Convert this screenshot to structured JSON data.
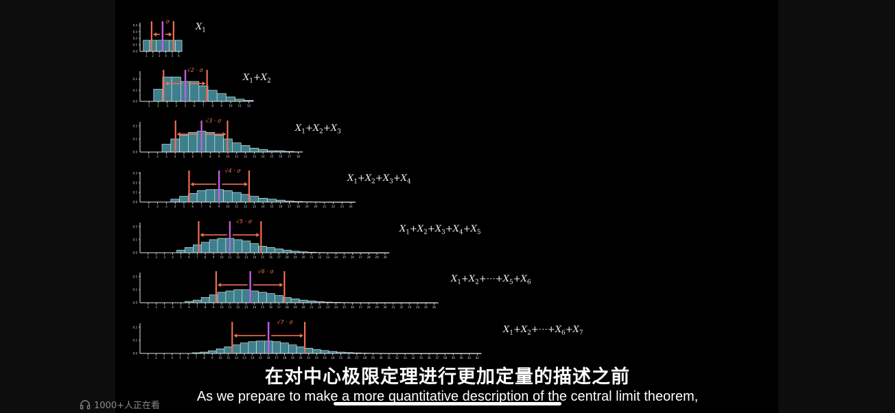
{
  "chart_data": [
    {
      "type": "bar",
      "label": "X_1",
      "var_main": "X",
      "var_sub": "1",
      "sigma_mult": "σ",
      "categories": [
        1,
        2,
        3,
        4,
        5,
        6
      ],
      "values": [
        0.17,
        0.17,
        0.17,
        0.17,
        0.17,
        0.17
      ],
      "xticks": [
        "1",
        "2",
        "3",
        "4",
        "5",
        "6"
      ],
      "yticks": [
        "0.1",
        "0.2",
        "0.3",
        "0.4"
      ],
      "ylim": [
        0,
        0.42
      ],
      "mean": 3.5
    },
    {
      "type": "bar",
      "label": "X_1 + X_2",
      "sigma_mult": "√2 · σ",
      "categories": [
        2,
        3,
        4,
        5,
        6,
        7,
        8,
        9,
        10,
        11,
        12
      ],
      "values": [
        0.11,
        0.22,
        0.22,
        0.18,
        0.18,
        0.14,
        0.1,
        0.07,
        0.04,
        0.02,
        0.01
      ],
      "xticks": [
        "1",
        "2",
        "3",
        "4",
        "5",
        "6",
        "7",
        "8",
        "9",
        "10",
        "11",
        "12"
      ],
      "yticks": [
        "0.1",
        "0.2"
      ],
      "ylim": [
        0,
        0.26
      ],
      "mean": 5.0
    },
    {
      "type": "bar",
      "label": "X_1 + X_2 + X_3",
      "sigma_mult": "√3 · σ",
      "categories": [
        3,
        4,
        5,
        6,
        7,
        8,
        9,
        10,
        11,
        12,
        13,
        14,
        15,
        16,
        17,
        18
      ],
      "values": [
        0.06,
        0.1,
        0.13,
        0.15,
        0.16,
        0.15,
        0.13,
        0.1,
        0.07,
        0.05,
        0.03,
        0.02,
        0.01,
        0.01,
        0.005,
        0.002
      ],
      "xticks": [
        "1",
        "2",
        "3",
        "4",
        "5",
        "6",
        "7",
        "8",
        "9",
        "10",
        "11",
        "12",
        "13",
        "14",
        "15",
        "16",
        "17",
        "18"
      ],
      "yticks": [
        "0.1",
        "0.2"
      ],
      "ylim": [
        0,
        0.22
      ],
      "mean": 7.0
    },
    {
      "type": "bar",
      "label": "X_1 + X_2 + X_3 + X_4",
      "sigma_mult": "√4 · σ",
      "categories": [
        4,
        5,
        6,
        7,
        8,
        9,
        10,
        11,
        12,
        13,
        14,
        15,
        16,
        17,
        18,
        19,
        20,
        21,
        22,
        23,
        24
      ],
      "values": [
        0.03,
        0.06,
        0.09,
        0.12,
        0.13,
        0.13,
        0.12,
        0.1,
        0.08,
        0.06,
        0.04,
        0.03,
        0.02,
        0.01,
        0.006,
        0.003,
        0.002,
        0.001,
        0.0005,
        0.0003,
        0.0001
      ],
      "xticks": [
        "1",
        "2",
        "3",
        "4",
        "5",
        "6",
        "7",
        "8",
        "9",
        "10",
        "11",
        "12",
        "13",
        "14",
        "15",
        "16",
        "17",
        "18",
        "19",
        "20",
        "21",
        "22",
        "23",
        "24"
      ],
      "yticks": [
        "0.1",
        "0.2",
        "0.3"
      ],
      "ylim": [
        0,
        0.3
      ],
      "mean": 9.0
    },
    {
      "type": "bar",
      "label": "X_1 + X_2 + X_3 + X_4 + X_5",
      "sigma_mult": "√5 · σ",
      "categories": [
        5,
        6,
        7,
        8,
        9,
        10,
        11,
        12,
        13,
        14,
        15,
        16,
        17,
        18,
        19,
        20,
        21,
        22,
        23,
        24,
        25,
        26,
        27,
        28,
        29,
        30
      ],
      "values": [
        0.02,
        0.04,
        0.06,
        0.08,
        0.1,
        0.11,
        0.11,
        0.1,
        0.09,
        0.07,
        0.05,
        0.04,
        0.03,
        0.02,
        0.012,
        0.007,
        0.004,
        0.002,
        0.001,
        0.0005,
        0.0003,
        0.0002,
        0.0001,
        0.0001,
        5e-05,
        3e-05
      ],
      "xticks": [
        "1",
        "2",
        "3",
        "4",
        "5",
        "6",
        "7",
        "8",
        "9",
        "10",
        "11",
        "12",
        "13",
        "14",
        "15",
        "16",
        "17",
        "18",
        "19",
        "20",
        "21",
        "22",
        "23",
        "24",
        "25",
        "26",
        "27",
        "28",
        "29",
        "30"
      ],
      "yticks": [
        "0.1",
        "0.2"
      ],
      "ylim": [
        0,
        0.22
      ],
      "mean": 11.0
    },
    {
      "type": "bar",
      "label": "X_1 + X_2 + ⋯ + X_5 + X_6",
      "sigma_mult": "√6 · σ",
      "categories": [
        6,
        7,
        8,
        9,
        10,
        11,
        12,
        13,
        14,
        15,
        16,
        17,
        18,
        19,
        20,
        21,
        22,
        23,
        24,
        25,
        26,
        27,
        28,
        29,
        30,
        31,
        32,
        33,
        34,
        35,
        36
      ],
      "values": [
        0.01,
        0.02,
        0.04,
        0.06,
        0.08,
        0.09,
        0.1,
        0.1,
        0.09,
        0.08,
        0.07,
        0.055,
        0.04,
        0.03,
        0.02,
        0.014,
        0.009,
        0.005,
        0.003,
        0.002,
        0.001,
        0.0006,
        0.0003,
        0.0002,
        0.0001,
        0.0001,
        5e-05,
        3e-05,
        2e-05,
        1e-05,
        1e-05
      ],
      "xticks": [
        "1",
        "2",
        "3",
        "4",
        "5",
        "6",
        "7",
        "8",
        "9",
        "10",
        "11",
        "12",
        "13",
        "14",
        "15",
        "16",
        "17",
        "18",
        "19",
        "20",
        "21",
        "22",
        "23",
        "24",
        "25",
        "26",
        "27",
        "28",
        "29",
        "30",
        "31",
        "32",
        "33",
        "34",
        "35",
        "36"
      ],
      "yticks": [
        "0.1",
        "0.2"
      ],
      "ylim": [
        0,
        0.22
      ],
      "mean": 13.5
    },
    {
      "type": "bar",
      "label": "X_1 + X_2 + ⋯ + X_6 + X_7",
      "sigma_mult": "√7 · σ",
      "categories": [
        7,
        8,
        9,
        10,
        11,
        12,
        13,
        14,
        15,
        16,
        17,
        18,
        19,
        20,
        21,
        22,
        23,
        24,
        25,
        26,
        27,
        28,
        29,
        30,
        31,
        32,
        33,
        34,
        35,
        36,
        37,
        38,
        39,
        40,
        41,
        42
      ],
      "values": [
        0.005,
        0.01,
        0.02,
        0.035,
        0.05,
        0.065,
        0.08,
        0.09,
        0.095,
        0.095,
        0.09,
        0.08,
        0.065,
        0.05,
        0.04,
        0.03,
        0.022,
        0.015,
        0.01,
        0.007,
        0.004,
        0.0025,
        0.0015,
        0.001,
        0.0006,
        0.0004,
        0.0002,
        0.0001,
        0.0001,
        5e-05,
        3e-05,
        2e-05,
        1e-05,
        1e-05,
        1e-05,
        1e-05
      ],
      "xticks": [
        "1",
        "2",
        "3",
        "4",
        "5",
        "6",
        "7",
        "8",
        "9",
        "10",
        "11",
        "12",
        "13",
        "14",
        "15",
        "16",
        "17",
        "18",
        "19",
        "20",
        "21",
        "22",
        "23",
        "24",
        "25",
        "26",
        "27",
        "28",
        "29",
        "30",
        "31",
        "32",
        "33",
        "34",
        "35",
        "36",
        "37",
        "38",
        "39",
        "40",
        "41",
        "42"
      ],
      "yticks": [
        "0.1",
        "0.2"
      ],
      "ylim": [
        0,
        0.22
      ],
      "mean": 16.0
    }
  ],
  "formulas": [
    [
      {
        "v": "X",
        "s": "1"
      }
    ],
    [
      {
        "v": "X",
        "s": "1"
      },
      {
        "op": "+"
      },
      {
        "v": "X",
        "s": "2"
      }
    ],
    [
      {
        "v": "X",
        "s": "1"
      },
      {
        "op": "+"
      },
      {
        "v": "X",
        "s": "2"
      },
      {
        "op": "+"
      },
      {
        "v": "X",
        "s": "3"
      }
    ],
    [
      {
        "v": "X",
        "s": "1"
      },
      {
        "op": "+"
      },
      {
        "v": "X",
        "s": "2"
      },
      {
        "op": "+"
      },
      {
        "v": "X",
        "s": "3"
      },
      {
        "op": "+"
      },
      {
        "v": "X",
        "s": "4"
      }
    ],
    [
      {
        "v": "X",
        "s": "1"
      },
      {
        "op": "+"
      },
      {
        "v": "X",
        "s": "2"
      },
      {
        "op": "+"
      },
      {
        "v": "X",
        "s": "3"
      },
      {
        "op": "+"
      },
      {
        "v": "X",
        "s": "4"
      },
      {
        "op": "+"
      },
      {
        "v": "X",
        "s": "5"
      }
    ],
    [
      {
        "v": "X",
        "s": "1"
      },
      {
        "op": "+"
      },
      {
        "v": "X",
        "s": "2"
      },
      {
        "op": "+⋯+"
      },
      {
        "v": "X",
        "s": "5"
      },
      {
        "op": "+"
      },
      {
        "v": "X",
        "s": "6"
      }
    ],
    [
      {
        "v": "X",
        "s": "1"
      },
      {
        "op": "+"
      },
      {
        "v": "X",
        "s": "2"
      },
      {
        "op": "+⋯+"
      },
      {
        "v": "X",
        "s": "6"
      },
      {
        "op": "+"
      },
      {
        "v": "X",
        "s": "7"
      }
    ]
  ],
  "colors": {
    "bar_fill": "#3d7f8c",
    "bar_stroke": "#d8e6ea",
    "sigma_line": "#f07052",
    "mean_line": "#c25ee0",
    "sigma_text": "#f07052",
    "axis": "#e6e6e6",
    "background": "#000000"
  },
  "subtitles": {
    "chinese": "在对中心极限定理进行更加定量的描述之前",
    "english": "As we prepare to make a more quantitative description of the central limit theorem,"
  },
  "viewers": {
    "icon": "headphones-icon",
    "text": "1000+人正在看"
  }
}
